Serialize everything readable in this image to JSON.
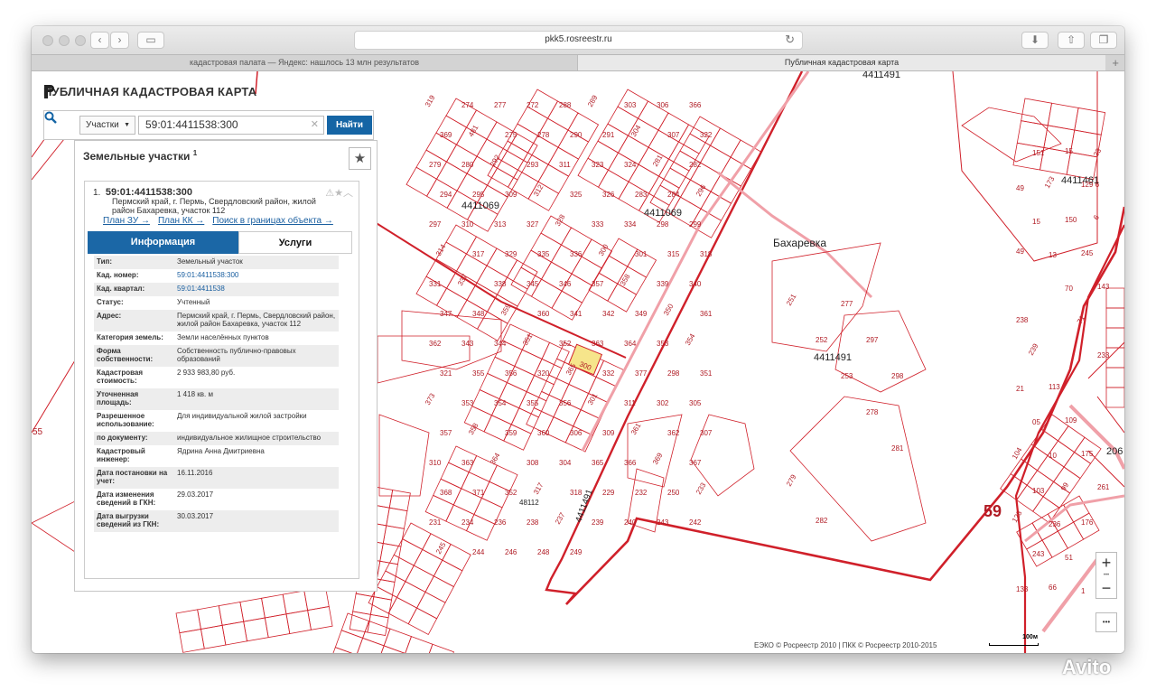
{
  "browser": {
    "url": "pkk5.rosreestr.ru",
    "tabs": [
      {
        "label": "кадастровая палата — Яндекс: нашлось 13 млн результатов",
        "active": false
      },
      {
        "label": "Публичная кадастровая карта",
        "active": true
      }
    ]
  },
  "app": {
    "title": "ПУБЛИЧНАЯ КАДАСТРОВАЯ КАРТА"
  },
  "search": {
    "type_label": "Участки",
    "value": "59:01:4411538:300",
    "button": "Найти"
  },
  "results": {
    "title": "Земельные участки",
    "count": "1",
    "item": {
      "index": "1.",
      "number": "59:01:4411538:300",
      "address": "Пермский край, г. Пермь, Свердловский район, жилой район Бахаревка, участок 112",
      "links": [
        "План ЗУ →",
        "План КК →",
        "Поиск в границах объекта →"
      ],
      "tabs": [
        "Информация",
        "Услуги"
      ],
      "attributes": [
        {
          "label": "Тип:",
          "value": "Земельный участок"
        },
        {
          "label": "Кад. номер:",
          "value": "59:01:4411538:300"
        },
        {
          "label": "Кад. квартал:",
          "value": "59:01:4411538"
        },
        {
          "label": "Статус:",
          "value": "Учтенный"
        },
        {
          "label": "Адрес:",
          "value": "Пермский край, г. Пермь, Свердловский район, жилой район Бахаревка, участок 112"
        },
        {
          "label": "Категория земель:",
          "value": "Земли населённых пунктов"
        },
        {
          "label": "Форма собственности:",
          "value": "Собственность публично-правовых образований"
        },
        {
          "label": "Кадастровая стоимость:",
          "value": "2 933 983,80 руб."
        },
        {
          "label": "Уточненная площадь:",
          "value": "1 418 кв. м"
        },
        {
          "label": "Разрешенное использование:",
          "value": "Для индивидуальной жилой застройки"
        },
        {
          "label": "по документу:",
          "value": "индивидуальное жилищное строительство"
        },
        {
          "label": "Кадастровый инженер:",
          "value": "Ядрина Анна Дмитриевна"
        },
        {
          "label": "Дата постановки на учет:",
          "value": "16.11.2016"
        },
        {
          "label": "Дата изменения сведений в ГКН:",
          "value": "29.03.2017"
        },
        {
          "label": "Дата выгрузки сведений из ГКН:",
          "value": "30.03.2017"
        }
      ]
    }
  },
  "map": {
    "labels": {
      "quarter_4411069_a": "4411069",
      "quarter_4411069_b": "4411069",
      "quarter_4411491_a": "4411491",
      "quarter_4411491_b": "4411491",
      "quarter_4411491_c": "4411491",
      "quarter_4411461": "4411461",
      "quarter_48112": "48112",
      "district": "Бахаревка",
      "region": "59",
      "edge_55": "55",
      "edge_206": "206",
      "selected_parcel": "300"
    },
    "parcels": [
      "319",
      "274",
      "277",
      "272",
      "288",
      "289",
      "303",
      "306",
      "366",
      "369",
      "481",
      "275",
      "278",
      "290",
      "291",
      "304",
      "307",
      "322",
      "279",
      "280",
      "292",
      "293",
      "311",
      "323",
      "324",
      "281",
      "282",
      "294",
      "295",
      "309",
      "312",
      "325",
      "326",
      "283",
      "284",
      "296",
      "297",
      "310",
      "313",
      "327",
      "328",
      "333",
      "334",
      "298",
      "299",
      "314",
      "317",
      "329",
      "335",
      "336",
      "300",
      "301",
      "315",
      "318",
      "331",
      "337",
      "338",
      "345",
      "346",
      "357",
      "358",
      "339",
      "340",
      "347",
      "348",
      "359",
      "360",
      "341",
      "342",
      "349",
      "350",
      "361",
      "362",
      "343",
      "344",
      "351",
      "352",
      "363",
      "364",
      "353",
      "354",
      "321",
      "355",
      "356",
      "320",
      "365",
      "332",
      "377",
      "298",
      "351",
      "373",
      "353",
      "354",
      "355",
      "356",
      "301",
      "311",
      "302",
      "305",
      "357",
      "358",
      "359",
      "360",
      "306",
      "309",
      "361",
      "362",
      "307",
      "310",
      "363",
      "364",
      "308",
      "304",
      "365",
      "366",
      "369",
      "367",
      "368",
      "371",
      "352",
      "317",
      "318",
      "229",
      "232",
      "250",
      "233",
      "231",
      "234",
      "236",
      "238",
      "237",
      "239",
      "240",
      "243",
      "242",
      "245",
      "244",
      "246",
      "248",
      "249",
      "251",
      "252",
      "253",
      "278",
      "281",
      "279",
      "282",
      "277",
      "297",
      "298",
      "104",
      "103",
      "236",
      "51",
      "1",
      "23",
      "49",
      "15",
      "13",
      "70",
      "71",
      "233",
      "21",
      "05",
      "10",
      "99",
      "176",
      "107",
      "133",
      "151",
      "173",
      "150",
      "245",
      "143",
      "238",
      "239",
      "113",
      "109",
      "175",
      "261",
      "128",
      "243",
      "66",
      "15",
      "129 6",
      "6",
      "49"
    ],
    "copyright": "ЕЭКО © Росреестр 2010 | ПКК © Росреестр 2010-2015",
    "scale": "100м"
  },
  "controls": {
    "zoom_in": "+",
    "zoom_out": "−",
    "more": "•••"
  },
  "watermark": "Avito",
  "colors": {
    "parcel": "#d0202a",
    "selected": "#f6e58b",
    "accent": "#1565a5"
  }
}
